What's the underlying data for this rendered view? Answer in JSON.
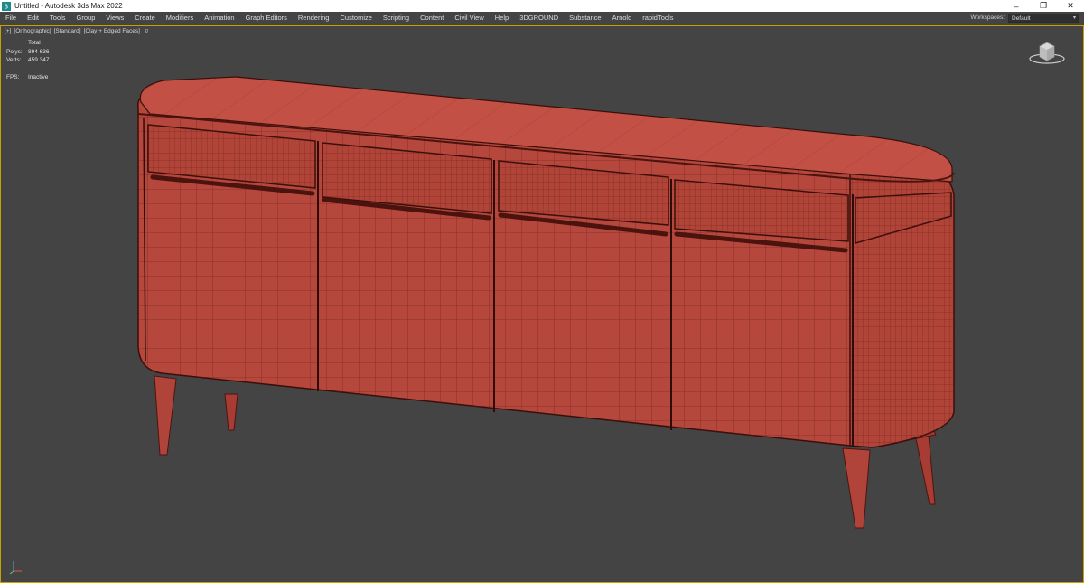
{
  "window": {
    "title": "Untitled - Autodesk 3ds Max 2022",
    "app_icon": "3dsmax-app-icon",
    "minimize_glyph": "–",
    "maximize_glyph": "❐",
    "close_glyph": "✕"
  },
  "menu": {
    "items": [
      "File",
      "Edit",
      "Tools",
      "Group",
      "Views",
      "Create",
      "Modifiers",
      "Animation",
      "Graph Editors",
      "Rendering",
      "Customize",
      "Scripting",
      "Content",
      "Civil View",
      "Help",
      "3DGROUND",
      "Substance",
      "Arnold",
      "rapidTools"
    ],
    "workspace_label": "Workspaces:",
    "workspace_value": "Default"
  },
  "viewport": {
    "labels": [
      "[+]",
      "[Orthographic]",
      "[Standard]",
      "[Clay + Edged Faces]"
    ],
    "filter_icon": "funnel-icon",
    "stats": {
      "header": "Total",
      "polys_label": "Polys:",
      "polys_value": "894 636",
      "verts_label": "Verts:",
      "verts_value": "459 347",
      "fps_label": "FPS:",
      "fps_value": "Inactive"
    },
    "viewcube_icon": "viewcube-icon",
    "axis_icon": "axis-tripod-icon"
  },
  "colors": {
    "viewport_bg": "#444444",
    "active_border": "#c8a000",
    "clay": "#b94a3f",
    "clay_dark": "#8e2f27",
    "wire": "#5a1a14"
  }
}
